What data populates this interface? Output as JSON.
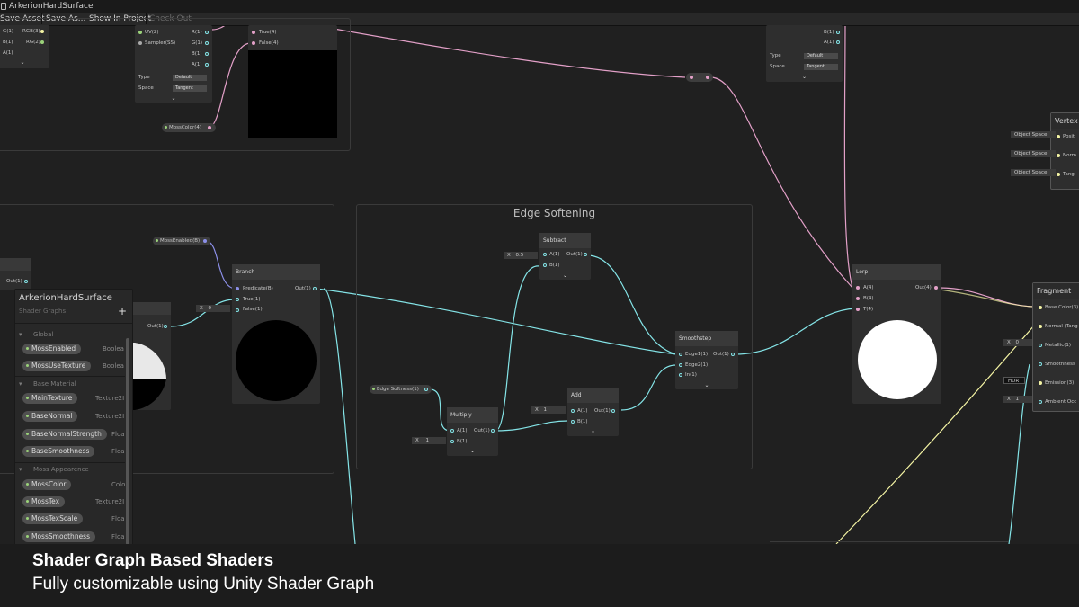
{
  "window": {
    "title": "ArkerionHardSurface"
  },
  "toolbar": {
    "save_asset": "Save Asset",
    "save_as": "Save As...",
    "show_in_project": "Show In Project",
    "check_out": "Check Out"
  },
  "top_left_node": {
    "ports_in": [
      "G(1)",
      "B(1)",
      "A(1)"
    ],
    "out": "RGB(3)",
    "out2": "RG(2)"
  },
  "sampler_node": {
    "uv": "UV(2)",
    "sampler": "Sampler(SS)",
    "r": "R(1)",
    "g": "G(1)",
    "b": "B(1)",
    "a": "A(1)",
    "type_label": "Type",
    "type_value": "Default",
    "space_label": "Space",
    "space_value": "Tangent"
  },
  "branch_top": {
    "true": "True(4)",
    "false": "False(4)"
  },
  "moss_color_prop": "MossColor(4)",
  "top_right_node": {
    "b": "B(1)",
    "a": "A(1)",
    "type_label": "Type",
    "type_value": "Default",
    "space_label": "Space",
    "space_value": "Tangent"
  },
  "vertex": {
    "title": "Vertex",
    "space": "Object Space",
    "ports": [
      "Posit",
      "Norm",
      "Tang"
    ]
  },
  "edge_group": {
    "title": "Edge Softening"
  },
  "subtract": {
    "title": "Subtract",
    "a": "A(1)",
    "b": "B(1)",
    "out": "Out(1)",
    "x_label": "X",
    "x_value": "0.5"
  },
  "multiply": {
    "title": "Multiply",
    "a": "A(1)",
    "b": "B(1)",
    "out": "Out(1)",
    "x_label": "X",
    "x_value": "1"
  },
  "add": {
    "title": "Add",
    "a": "A(1)",
    "b": "B(1)",
    "out": "Out(1)",
    "x_label": "X",
    "x_value": "1"
  },
  "edge_softness_prop": "Edge Softness(1)",
  "smoothstep": {
    "title": "Smoothstep",
    "edge1": "Edge1(1)",
    "edge2": "Edge2(1)",
    "in": "In(1)",
    "out": "Out(1)"
  },
  "lerp": {
    "title": "Lerp",
    "a": "A(4)",
    "b": "B(4)",
    "t": "T(4)",
    "out": "Out(4)"
  },
  "branch": {
    "title": "Branch",
    "predicate": "Predicate(B)",
    "true": "True(1)",
    "false": "False(1)",
    "out": "Out(1)",
    "x_label": "X",
    "x_value": "0"
  },
  "moss_enabled_prop": "MossEnabled(B)",
  "left_nodes": {
    "out1": "Out(1)",
    "out2": "Out(1)"
  },
  "fragment": {
    "title": "Fragment",
    "ports": [
      "Base Color(3)",
      "Normal (Tang",
      "Metallic(1)",
      "Smoothness",
      "Emission(3)",
      "Ambient Occ"
    ],
    "metallic_x": "X",
    "metallic_value": "0",
    "hdr": "HDR",
    "ao_x": "X",
    "ao_value": "1"
  },
  "blackboard": {
    "title": "ArkerionHardSurface",
    "subtitle": "Shader Graphs",
    "add_symbol": "+",
    "categories": [
      {
        "name": "Global",
        "items": [
          {
            "name": "MossEnabled",
            "type": "Boolea"
          },
          {
            "name": "MossUseTexture",
            "type": "Boolea"
          }
        ]
      },
      {
        "name": "Base Material",
        "items": [
          {
            "name": "MainTexture",
            "type": "Texture2I"
          },
          {
            "name": "BaseNormal",
            "type": "Texture2I"
          },
          {
            "name": "BaseNormalStrength",
            "type": "Floa"
          },
          {
            "name": "BaseSmoothness",
            "type": "Floa"
          }
        ]
      },
      {
        "name": "Moss Appearence",
        "items": [
          {
            "name": "MossColor",
            "type": "Colo"
          },
          {
            "name": "MossTex",
            "type": "Texture2I"
          },
          {
            "name": "MossTexScale",
            "type": "Floa"
          },
          {
            "name": "MossSmoothness",
            "type": "Floa"
          }
        ]
      }
    ]
  },
  "caption": {
    "title": "Shader Graph Based Shaders",
    "subtitle": "Fully customizable using Unity Shader Graph"
  },
  "colors": {
    "wire_pink": "#e3a0c8",
    "wire_cyan": "#84e4e7",
    "wire_yellow": "#f4f4a4",
    "wire_purple": "#8c8fe8",
    "background": "#202020"
  }
}
